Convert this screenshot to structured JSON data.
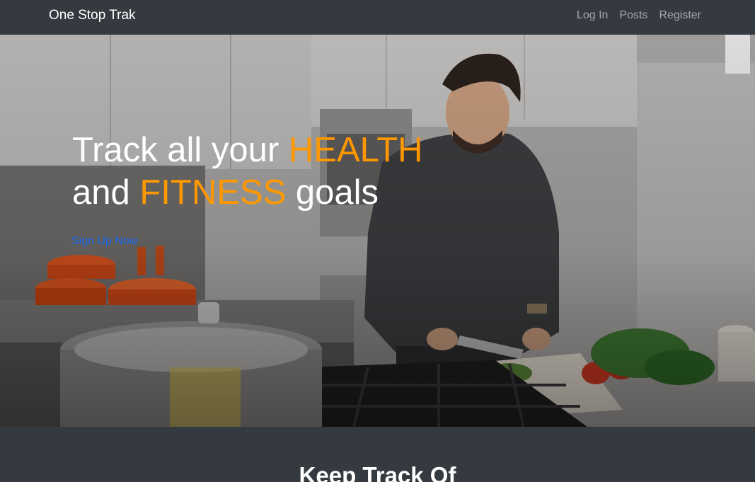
{
  "navbar": {
    "brand": "One Stop Trak",
    "links": [
      {
        "label": "Log In"
      },
      {
        "label": "Posts"
      },
      {
        "label": "Register"
      }
    ]
  },
  "hero": {
    "headline": {
      "part1": "Track all your ",
      "accent1": "HEALTH",
      "part2": "and ",
      "accent2": "FITNESS",
      "part3": " goals"
    },
    "cta": "Sign Up Now",
    "background_image": "man-cooking-in-kitchen",
    "accent_color": "#ff9800",
    "link_color": "#1a6af0"
  },
  "section": {
    "title": "Keep Track Of"
  }
}
